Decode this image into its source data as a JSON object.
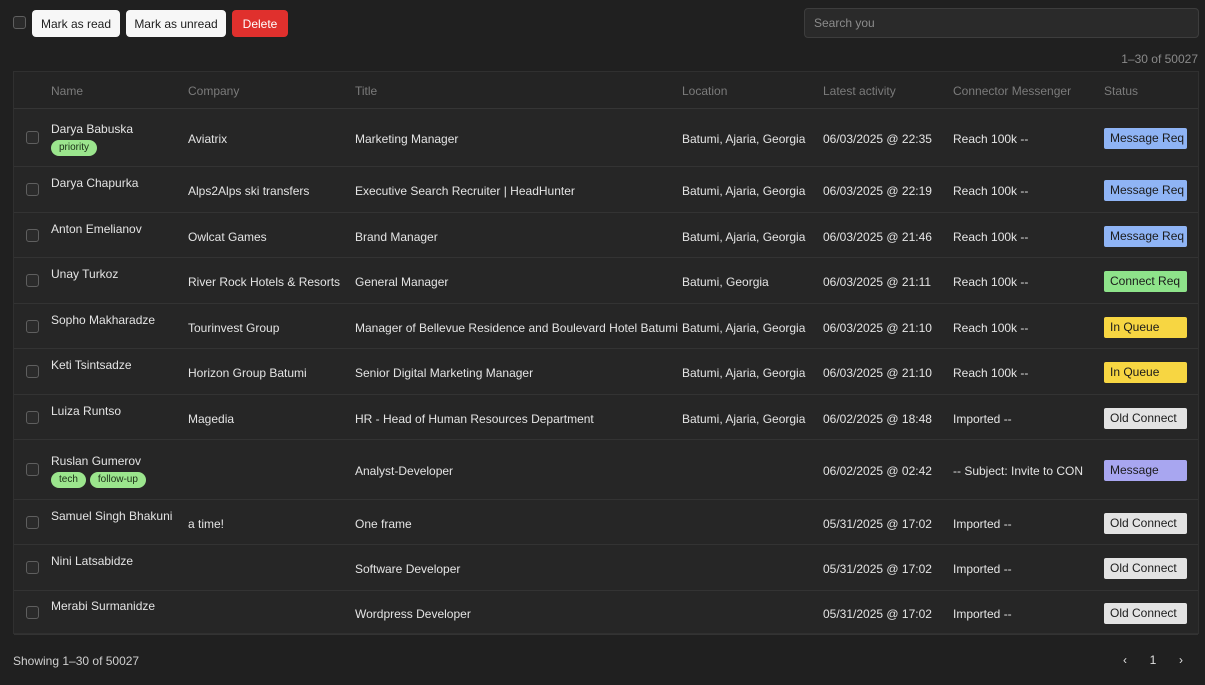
{
  "toolbar": {
    "mark_read": "Mark as read",
    "mark_unread": "Mark as unread",
    "delete": "Delete",
    "search_placeholder": "Search you"
  },
  "range_top": "1–30 of 50027",
  "columns": [
    "Name",
    "Company",
    "Title",
    "Location",
    "Latest activity",
    "Connector Messenger",
    "Status"
  ],
  "rows": [
    {
      "name": "Darya Babuska",
      "tags": [
        "priority"
      ],
      "company": "Aviatrix",
      "title": "Marketing Manager",
      "location": "Batumi, Ajaria, Georgia",
      "activity": "06/03/2025 @ 22:35",
      "messenger": "Reach 100k --",
      "status": "Message Req",
      "status_color": "#8fb4f5"
    },
    {
      "name": "Darya Chapurka",
      "tags": [],
      "company": "Alps2Alps ski transfers",
      "title": "Executive Search Recruiter | HeadHunter",
      "location": "Batumi, Ajaria, Georgia",
      "activity": "06/03/2025 @ 22:19",
      "messenger": "Reach 100k --",
      "status": "Message Req",
      "status_color": "#8fb4f5"
    },
    {
      "name": "Anton Emelianov",
      "tags": [],
      "company": "Owlcat Games",
      "title": "Brand Manager",
      "location": "Batumi, Ajaria, Georgia",
      "activity": "06/03/2025 @ 21:46",
      "messenger": "Reach 100k --",
      "status": "Message Req",
      "status_color": "#8fb4f5"
    },
    {
      "name": "Unay Turkoz",
      "tags": [],
      "company": "River Rock Hotels & Resorts",
      "title": "General Manager",
      "location": "Batumi, Georgia",
      "activity": "06/03/2025 @ 21:11",
      "messenger": "Reach 100k --",
      "status": "Connect Req",
      "status_color": "#8ee38a"
    },
    {
      "name": "Sopho Makharadze",
      "tags": [],
      "company": "Tourinvest Group",
      "title": "Manager of Bellevue Residence and Boulevard Hotel Batumi",
      "location": "Batumi, Ajaria, Georgia",
      "activity": "06/03/2025 @ 21:10",
      "messenger": "Reach 100k --",
      "status": "In Queue",
      "status_color": "#f7d642"
    },
    {
      "name": "Keti Tsintsadze",
      "tags": [],
      "company": "Horizon Group Batumi",
      "title": "Senior Digital Marketing Manager",
      "location": "Batumi, Ajaria, Georgia",
      "activity": "06/03/2025 @ 21:10",
      "messenger": "Reach 100k --",
      "status": "In Queue",
      "status_color": "#f7d642"
    },
    {
      "name": "Luiza Runtso",
      "tags": [],
      "company": "Magedia",
      "title": "HR - Head of Human Resources Department",
      "location": "Batumi, Ajaria, Georgia",
      "activity": "06/02/2025 @ 18:48",
      "messenger": "Imported --",
      "status": "Old Connect",
      "status_color": "#e3e3e3"
    },
    {
      "name": "Ruslan Gumerov",
      "tags": [
        "tech",
        "follow-up"
      ],
      "company": "",
      "title": "Analyst-Developer",
      "location": "",
      "activity": "06/02/2025 @ 02:42",
      "messenger": "-- Subject: Invite to CON",
      "status": "Message",
      "status_color": "#a8a6f0"
    },
    {
      "name": "Samuel Singh Bhakuni",
      "tags": [],
      "company": "a time!",
      "title": "One frame",
      "location": "",
      "activity": "05/31/2025 @ 17:02",
      "messenger": "Imported --",
      "status": "Old Connect",
      "status_color": "#e3e3e3"
    },
    {
      "name": "Nini Latsabidze",
      "tags": [],
      "company": "",
      "title": "Software Developer",
      "location": "",
      "activity": "05/31/2025 @ 17:02",
      "messenger": "Imported --",
      "status": "Old Connect",
      "status_color": "#e3e3e3"
    },
    {
      "name": "Merabi Surmanidze",
      "tags": [],
      "company": "",
      "title": "Wordpress Developer",
      "location": "",
      "activity": "05/31/2025 @ 17:02",
      "messenger": "Imported --",
      "status": "Old Connect",
      "status_color": "#e3e3e3"
    }
  ],
  "footer": {
    "showing": "Showing 1–30 of 50027",
    "prev_icon": "‹",
    "page": "1",
    "next_icon": "›"
  }
}
